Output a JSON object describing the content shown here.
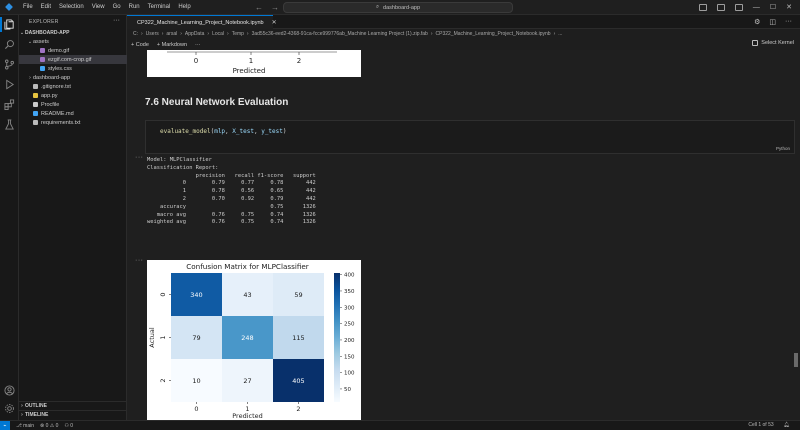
{
  "menu": [
    "File",
    "Edit",
    "Selection",
    "View",
    "Go",
    "Run",
    "Terminal",
    "Help"
  ],
  "command_center": "dashboard-app",
  "explorer": {
    "title": "EXPLORER",
    "root": "DASHBOARD-APP",
    "items": [
      {
        "label": "assets",
        "type": "folder",
        "depth": 1,
        "open": true
      },
      {
        "label": "demo.gif",
        "type": "gif",
        "depth": 2
      },
      {
        "label": "ezgif.com-crop.gif",
        "type": "gif",
        "depth": 2,
        "selected": true
      },
      {
        "label": "styles.css",
        "type": "css",
        "depth": 2
      },
      {
        "label": "dashboard-app",
        "type": "folder",
        "depth": 1,
        "open": false
      },
      {
        "label": ".gitignore.txt",
        "type": "txt",
        "depth": 1
      },
      {
        "label": "app.py",
        "type": "py",
        "depth": 1
      },
      {
        "label": "Procfile",
        "type": "file",
        "depth": 1
      },
      {
        "label": "README.md",
        "type": "md",
        "depth": 1
      },
      {
        "label": "requirements.txt",
        "type": "txt",
        "depth": 1
      }
    ],
    "outline": "OUTLINE",
    "timeline": "TIMELINE"
  },
  "tab": {
    "label": "CP322_Machine_Learning_Project_Notebook.ipynb"
  },
  "breadcrumb": [
    "C:",
    "Users",
    "arsal",
    "AppData",
    "Local",
    "Temp",
    "3ad55c36-eed2-4368-91ca-fcce999776ab_Machine Learning Project (1).zip.fab",
    "CP322_Machine_Learning_Project_Notebook.ipynb",
    "..."
  ],
  "toolbar": {
    "code_label": "+ Code",
    "markdown_label": "+ Markdown",
    "more": "···",
    "kernel": "Select Kernel"
  },
  "notebook": {
    "heading": "7.6 Neural Network Evaluation",
    "code_fn": "evaluate_model",
    "code_args": [
      "mlp",
      "X_test",
      "y_test"
    ],
    "language": "Python",
    "gutter": "···",
    "top_fig_ticks": [
      "0",
      "1",
      "2"
    ],
    "top_fig_xlabel": "Predicted"
  },
  "report": {
    "model_line": "Model: MLPClassifier",
    "title": "Classification Report:",
    "header": [
      "precision",
      "recall",
      "f1-score",
      "support"
    ],
    "rows": [
      {
        "label": "0",
        "values": [
          "0.79",
          "0.77",
          "0.78",
          "442"
        ]
      },
      {
        "label": "1",
        "values": [
          "0.78",
          "0.56",
          "0.65",
          "442"
        ]
      },
      {
        "label": "2",
        "values": [
          "0.70",
          "0.92",
          "0.79",
          "442"
        ]
      }
    ],
    "accuracy": {
      "label": "accuracy",
      "values": [
        "",
        "",
        "0.75",
        "1326"
      ]
    },
    "macro": {
      "label": "macro avg",
      "values": [
        "0.76",
        "0.75",
        "0.74",
        "1326"
      ]
    },
    "weighted": {
      "label": "weighted avg",
      "values": [
        "0.76",
        "0.75",
        "0.74",
        "1326"
      ]
    }
  },
  "chart_data": {
    "type": "heatmap",
    "title": "Confusion Matrix for MLPClassifier",
    "xlabel": "Predicted",
    "ylabel": "Actual",
    "x_ticks": [
      "0",
      "1",
      "2"
    ],
    "y_ticks": [
      "0",
      "1",
      "2"
    ],
    "matrix": [
      [
        340,
        43,
        59
      ],
      [
        79,
        248,
        115
      ],
      [
        10,
        27,
        405
      ]
    ],
    "colorbar": {
      "min": 10,
      "max": 405,
      "ticks": [
        50,
        100,
        150,
        200,
        250,
        300,
        350,
        400
      ]
    },
    "colormap": "Blues"
  },
  "status": {
    "branch": "main",
    "problems": "⊗ 0 ⚠ 0",
    "ports": "0",
    "cell": "Cell 1 of 53"
  }
}
